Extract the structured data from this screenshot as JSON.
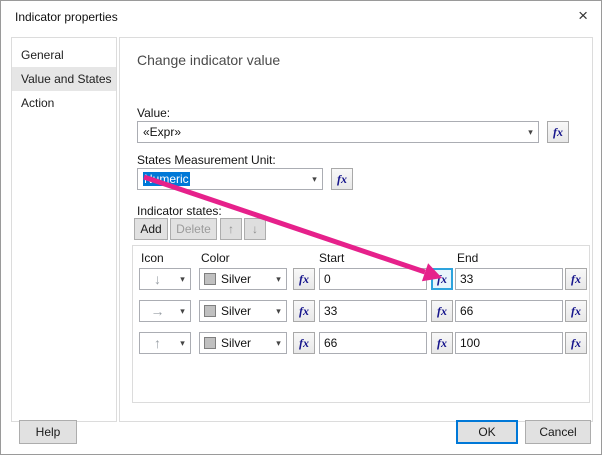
{
  "window": {
    "title": "Indicator properties"
  },
  "icons": {
    "close": "×",
    "caret": "▾",
    "up_arrow": "↑",
    "down_arrow": "↓",
    "fx": "fx"
  },
  "sidebar": {
    "items": [
      {
        "label": "General",
        "selected": false
      },
      {
        "label": "Value and States",
        "selected": true
      },
      {
        "label": "Action",
        "selected": false
      }
    ]
  },
  "main": {
    "heading": "Change indicator value",
    "value": {
      "label": "Value:",
      "selected_value": "«Expr»"
    },
    "measurement_unit": {
      "label": "States Measurement Unit:",
      "selected_value": "Numeric"
    },
    "indicator_states": {
      "label": "Indicator states:",
      "add_label": "Add",
      "delete_label": "Delete",
      "table": {
        "headers": [
          "Icon",
          "Color",
          "Start",
          "End"
        ],
        "rows": [
          {
            "icon": "arrow-down",
            "icon_glyph": "↓",
            "color": "Silver",
            "start": "0",
            "end": "33"
          },
          {
            "icon": "arrow-right",
            "icon_glyph": "→",
            "color": "Silver",
            "start": "33",
            "end": "66"
          },
          {
            "icon": "arrow-up",
            "icon_glyph": "↑",
            "color": "Silver",
            "start": "66",
            "end": "100"
          }
        ]
      }
    }
  },
  "footer": {
    "help": "Help",
    "ok": "OK",
    "cancel": "Cancel"
  },
  "colors": {
    "accent": "#0078d7",
    "annotation_arrow": "#e6218b",
    "silver_swatch": "#c0c0c0",
    "fx_highlight_border": "#2ea3dd",
    "sidebar_selected_bg": "#e6e6e6"
  }
}
